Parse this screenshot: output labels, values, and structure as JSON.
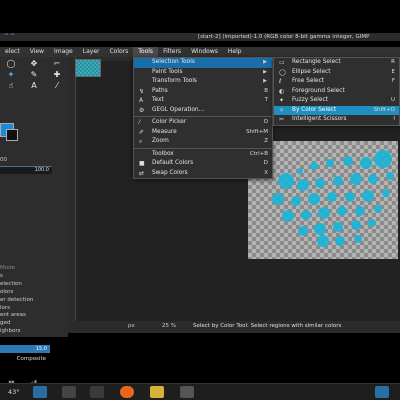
{
  "window": {
    "title": "[start-2] (imported)-1.0 (RGB color 8-bit gamma integer, GIMP",
    "logo": "^^"
  },
  "menubar": {
    "items": [
      "elect",
      "View",
      "Image",
      "Layer",
      "Colors",
      "Tools",
      "Filters",
      "Windows",
      "Help"
    ],
    "active": "Tools"
  },
  "tools_menu": {
    "items": [
      {
        "icon": "",
        "label": "Selection Tools",
        "shortcut": "",
        "submenu": true,
        "highlight": true
      },
      {
        "icon": "",
        "label": "Paint Tools",
        "shortcut": "",
        "submenu": true
      },
      {
        "icon": "",
        "label": "Transform Tools",
        "shortcut": "",
        "submenu": true
      },
      {
        "icon": "path-icon",
        "label": "Paths",
        "shortcut": "B"
      },
      {
        "icon": "text-icon",
        "label": "Text",
        "shortcut": "T"
      },
      {
        "icon": "gegl-icon",
        "label": "GEGL Operation...",
        "shortcut": ""
      },
      {
        "icon": "color-picker-icon",
        "label": "Color Picker",
        "shortcut": "O"
      },
      {
        "icon": "measure-icon",
        "label": "Measure",
        "shortcut": "Shift+M"
      },
      {
        "icon": "zoom-icon",
        "label": "Zoom",
        "shortcut": "Z"
      },
      {
        "icon": "",
        "label": "Toolbox",
        "shortcut": "Ctrl+B"
      },
      {
        "icon": "default-colors-icon",
        "label": "Default Colors",
        "shortcut": "D"
      },
      {
        "icon": "swap-colors-icon",
        "label": "Swap Colors",
        "shortcut": "X"
      }
    ]
  },
  "selection_submenu": {
    "items": [
      {
        "label": "Rectangle Select",
        "shortcut": "R"
      },
      {
        "label": "Ellipse Select",
        "shortcut": "E"
      },
      {
        "label": "Free Select",
        "shortcut": "F"
      },
      {
        "label": "Foreground Select",
        "shortcut": ""
      },
      {
        "label": "Fuzzy Select",
        "shortcut": "U"
      },
      {
        "label": "By Color Select",
        "shortcut": "Shift+O",
        "highlight": true
      },
      {
        "label": "Intelligent Scissors",
        "shortcut": "I"
      }
    ]
  },
  "toolbox": {
    "size_value": "100.0",
    "size_label": "00",
    "list_header": "Mode",
    "list": [
      "s",
      "election",
      "olors",
      "er detection",
      "lors",
      "ent areas",
      "ged",
      "ighbors"
    ],
    "opacity_value": "15.0",
    "mode_value": "Composite"
  },
  "statusbar": {
    "unit": "px",
    "zoom": "25 %",
    "message": "Select by Color Tool: Select regions with similar colors"
  },
  "taskbar": {
    "temperature": "43°"
  },
  "colors": {
    "accent": "#1a6ea8",
    "highlight": "#1f8fc0",
    "menu_bg": "#2f2f2f",
    "dot_color": "#17b4d8"
  }
}
